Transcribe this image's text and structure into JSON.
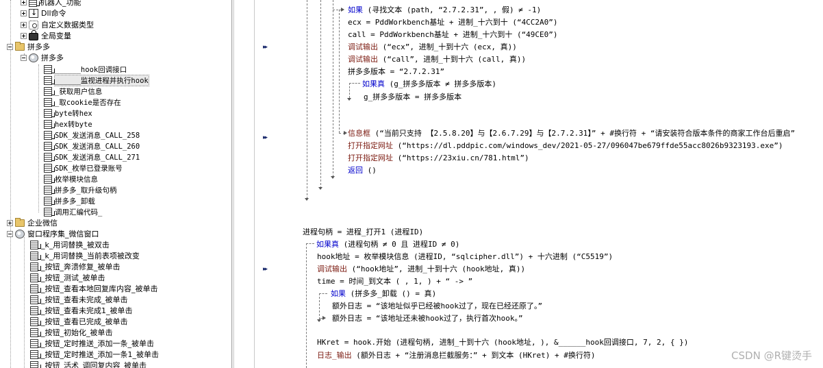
{
  "tree": {
    "items": [
      {
        "label": "机器人_功能",
        "icon": "sub-program-icon"
      },
      {
        "label": "Dll命令",
        "icon": "dll-icon"
      },
      {
        "label": "自定义数据类型",
        "icon": "data-type-icon"
      },
      {
        "label": "全局变量",
        "icon": "global-var-icon"
      },
      {
        "label": "拼多多",
        "icon": "folder-icon"
      },
      {
        "label": "拼多多",
        "icon": "module-icon"
      },
      {
        "label": "______hook回调接口",
        "icon": "sub-program-icon"
      },
      {
        "label": "______监视进程并执行hook",
        "icon": "sub-program-icon"
      },
      {
        "label": "_获取用户信息",
        "icon": "sub-program-icon"
      },
      {
        "label": "_取cookie是否存在",
        "icon": "sub-program-icon"
      },
      {
        "label": "byte转hex",
        "icon": "sub-program-icon"
      },
      {
        "label": "hex转byte",
        "icon": "sub-program-icon"
      },
      {
        "label": "SDK_发送消息_CALL_258",
        "icon": "sub-program-icon"
      },
      {
        "label": "SDK_发送消息_CALL_260",
        "icon": "sub-program-icon"
      },
      {
        "label": "SDK_发送消息_CALL_271",
        "icon": "sub-program-icon"
      },
      {
        "label": "SDK_枚举已登录账号",
        "icon": "sub-program-icon"
      },
      {
        "label": "枚举模块信息",
        "icon": "sub-program-icon"
      },
      {
        "label": "拼多多_取升级句柄",
        "icon": "sub-program-icon"
      },
      {
        "label": "拼多多_卸载",
        "icon": "sub-program-icon"
      },
      {
        "label": "调用汇编代码_",
        "icon": "sub-program-icon"
      },
      {
        "label": "企业微信",
        "icon": "folder-icon"
      },
      {
        "label": "窗口程序集_微信窗口",
        "icon": "module-icon"
      },
      {
        "label": "_k_用词替换_被双击",
        "icon": "sub-program-icon"
      },
      {
        "label": "_k_用词替换_当前表项被改变",
        "icon": "sub-program-icon"
      },
      {
        "label": "_按钮_奔溃修复_被单击",
        "icon": "sub-program-icon"
      },
      {
        "label": "_按钮_测试_被单击",
        "icon": "sub-program-icon"
      },
      {
        "label": "_按钮_查看本地回复库内容_被单击",
        "icon": "sub-program-icon"
      },
      {
        "label": "_按钮_查看未完成_被单击",
        "icon": "sub-program-icon"
      },
      {
        "label": "_按钮_查看未完成1_被单击",
        "icon": "sub-program-icon"
      },
      {
        "label": "_按钮_查看已完成_被单击",
        "icon": "sub-program-icon"
      },
      {
        "label": "_按钮_初始化_被单击",
        "icon": "sub-program-icon"
      },
      {
        "label": "_按钮_定时推送_添加一条_被单击",
        "icon": "sub-program-icon"
      },
      {
        "label": "_按钮_定时推送_添加一条1_被单击",
        "icon": "sub-program-icon"
      },
      {
        "label": "_按钮_活术_调回复内容_被单击",
        "icon": "sub-program-icon"
      }
    ]
  },
  "code": {
    "lines": [
      [
        {
          "t": "如果",
          "c": "kw"
        },
        {
          "t": " (寻找文本 (path, “2.7.2.31”, , 假) ≠ -1)",
          "c": "plain"
        }
      ],
      [
        {
          "t": "ecx = PddWorkbench基址 + 进制_十六到十 (“4CC2A0”)",
          "c": "plain"
        }
      ],
      [
        {
          "t": "call = PddWorkbench基址 + 进制_十六到十 (“49CE0”)",
          "c": "plain"
        }
      ],
      [
        {
          "t": "调试输出",
          "c": "cmd"
        },
        {
          "t": " (“ecx”, 进制_十到十六 (ecx, 真))",
          "c": "plain"
        }
      ],
      [
        {
          "t": "调试输出",
          "c": "cmd"
        },
        {
          "t": " (“call”, 进制_十到十六 (call, 真))",
          "c": "plain"
        }
      ],
      [
        {
          "t": "拼多多版本 = “2.7.2.31”",
          "c": "plain"
        }
      ],
      [
        {
          "t": "如果真",
          "c": "kw"
        },
        {
          "t": " (g_拼多多版本 ≠ 拼多多版本)",
          "c": "plain"
        }
      ],
      [
        {
          "t": "g_拼多多版本 = 拼多多版本",
          "c": "plain"
        }
      ],
      [
        {
          "t": "信息框",
          "c": "cmd"
        },
        {
          "t": " (“当前只支持 【2.5.8.20】与【2.6.7.29】与【2.7.2.31】” + #换行符 + “请安装符合版本条件的商家工作台后重启”",
          "c": "plain"
        }
      ],
      [
        {
          "t": "打开指定网址",
          "c": "cmd"
        },
        {
          "t": " (“https://dl.pddpic.com/windows_dev/2021-05-27/096047be679ffde55acc8026b9323193.exe”)",
          "c": "plain"
        }
      ],
      [
        {
          "t": "打开指定网址",
          "c": "cmd"
        },
        {
          "t": " (“https://23xiu.cn/781.html”)",
          "c": "plain"
        }
      ],
      [
        {
          "t": "返回",
          "c": "kw"
        },
        {
          "t": " ()",
          "c": "plain"
        }
      ],
      [
        {
          "t": "进程句柄 = 进程_打开1 (进程ID)",
          "c": "plain"
        }
      ],
      [
        {
          "t": "如果真",
          "c": "kw"
        },
        {
          "t": " (进程句柄 ≠ 0 且 进程ID ≠ 0)",
          "c": "plain"
        }
      ],
      [
        {
          "t": "hook地址 = 枚举模块信息 (进程ID, “sqlcipher.dll”) + 十六进制 (“C5519”)",
          "c": "plain"
        }
      ],
      [
        {
          "t": "调试输出",
          "c": "cmd"
        },
        {
          "t": " (“hook地址”, 进制_十到十六 (hook地址, 真))",
          "c": "plain"
        }
      ],
      [
        {
          "t": "time = 时间_到文本 ( , 1, ) + “ -> ”",
          "c": "plain"
        }
      ],
      [
        {
          "t": "如果",
          "c": "kw"
        },
        {
          "t": " (拼多多_卸载 () = 真)",
          "c": "plain"
        }
      ],
      [
        {
          "t": "额外日志 = “该地址似乎已经被hook过了，现在已经还原了。”",
          "c": "plain"
        }
      ],
      [
        {
          "t": "额外日志 = “该地址还未被hook过了，执行首次hook。”",
          "c": "plain"
        }
      ],
      [
        {
          "t": "HKret = hook.开始 (进程句柄, 进制_十到十六 (hook地址, ), &______hook回调接口, 7, 2, {  })",
          "c": "plain"
        }
      ],
      [
        {
          "t": "日志_输出",
          "c": "cmd"
        },
        {
          "t": " (额外日志 + “注册消息拦截服务：” + 到文本 (HKret) + #换行符)",
          "c": "plain"
        }
      ]
    ]
  },
  "watermark": "CSDN @R键烫手"
}
